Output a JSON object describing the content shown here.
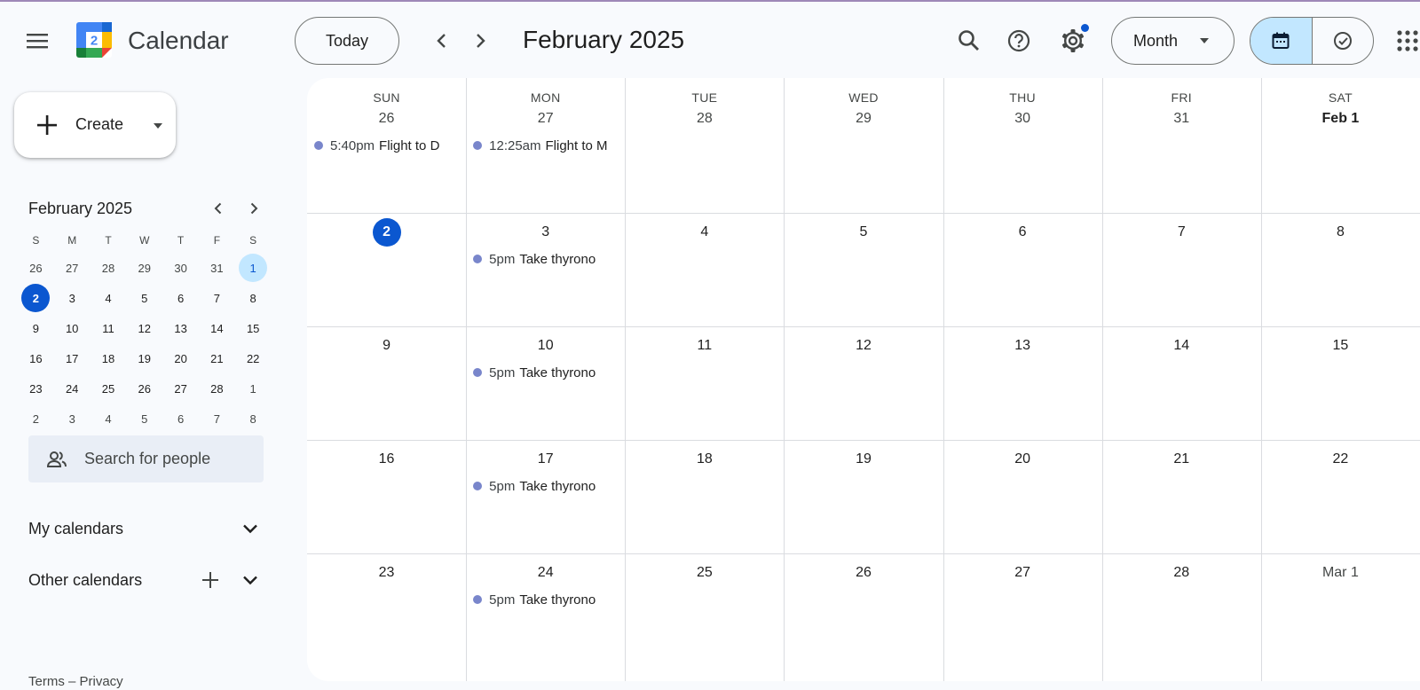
{
  "header": {
    "app_title": "Calendar",
    "logo_number": "2",
    "today_label": "Today",
    "month_title": "February 2025",
    "view_select": "Month"
  },
  "sidebar": {
    "create_label": "Create",
    "mini": {
      "title": "February 2025",
      "weekdays": [
        "S",
        "M",
        "T",
        "W",
        "T",
        "F",
        "S"
      ],
      "weeks": [
        [
          "26",
          "27",
          "28",
          "29",
          "30",
          "31",
          "1"
        ],
        [
          "2",
          "3",
          "4",
          "5",
          "6",
          "7",
          "8"
        ],
        [
          "9",
          "10",
          "11",
          "12",
          "13",
          "14",
          "15"
        ],
        [
          "16",
          "17",
          "18",
          "19",
          "20",
          "21",
          "22"
        ],
        [
          "23",
          "24",
          "25",
          "26",
          "27",
          "28",
          "1"
        ],
        [
          "2",
          "3",
          "4",
          "5",
          "6",
          "7",
          "8"
        ]
      ]
    },
    "search_people_placeholder": "Search for people",
    "my_calendars": "My calendars",
    "other_calendars": "Other calendars",
    "footer": "Terms – Privacy"
  },
  "calendar": {
    "weekdays": [
      "SUN",
      "MON",
      "TUE",
      "WED",
      "THU",
      "FRI",
      "SAT"
    ],
    "weeks": [
      [
        "26",
        "27",
        "28",
        "29",
        "30",
        "31",
        "Feb 1"
      ],
      [
        "2",
        "3",
        "4",
        "5",
        "6",
        "7",
        "8"
      ],
      [
        "9",
        "10",
        "11",
        "12",
        "13",
        "14",
        "15"
      ],
      [
        "16",
        "17",
        "18",
        "19",
        "20",
        "21",
        "22"
      ],
      [
        "23",
        "24",
        "25",
        "26",
        "27",
        "28",
        "Mar 1"
      ]
    ],
    "events": {
      "w0d0": {
        "time": "5:40pm",
        "title": "Flight to D"
      },
      "w0d1": {
        "time": "12:25am",
        "title": "Flight to M"
      },
      "w1d1": {
        "time": "5pm",
        "title": "Take thyrono"
      },
      "w2d1": {
        "time": "5pm",
        "title": "Take thyrono"
      },
      "w3d1": {
        "time": "5pm",
        "title": "Take thyrono"
      },
      "w4d1": {
        "time": "5pm",
        "title": "Take thyrono"
      }
    }
  },
  "colors": {
    "accent": "#0b57d0",
    "selected_bg": "#c2e7ff",
    "event_dot": "#7986cb"
  },
  "icons": [
    "menu-icon",
    "calendar-logo-icon",
    "chevron-left-icon",
    "chevron-right-icon",
    "search-icon",
    "help-icon",
    "gear-icon",
    "dropdown-caret-icon",
    "calendar-view-icon",
    "tasks-check-icon",
    "apps-grid-icon",
    "plus-icon",
    "people-icon",
    "chevron-down-icon"
  ]
}
